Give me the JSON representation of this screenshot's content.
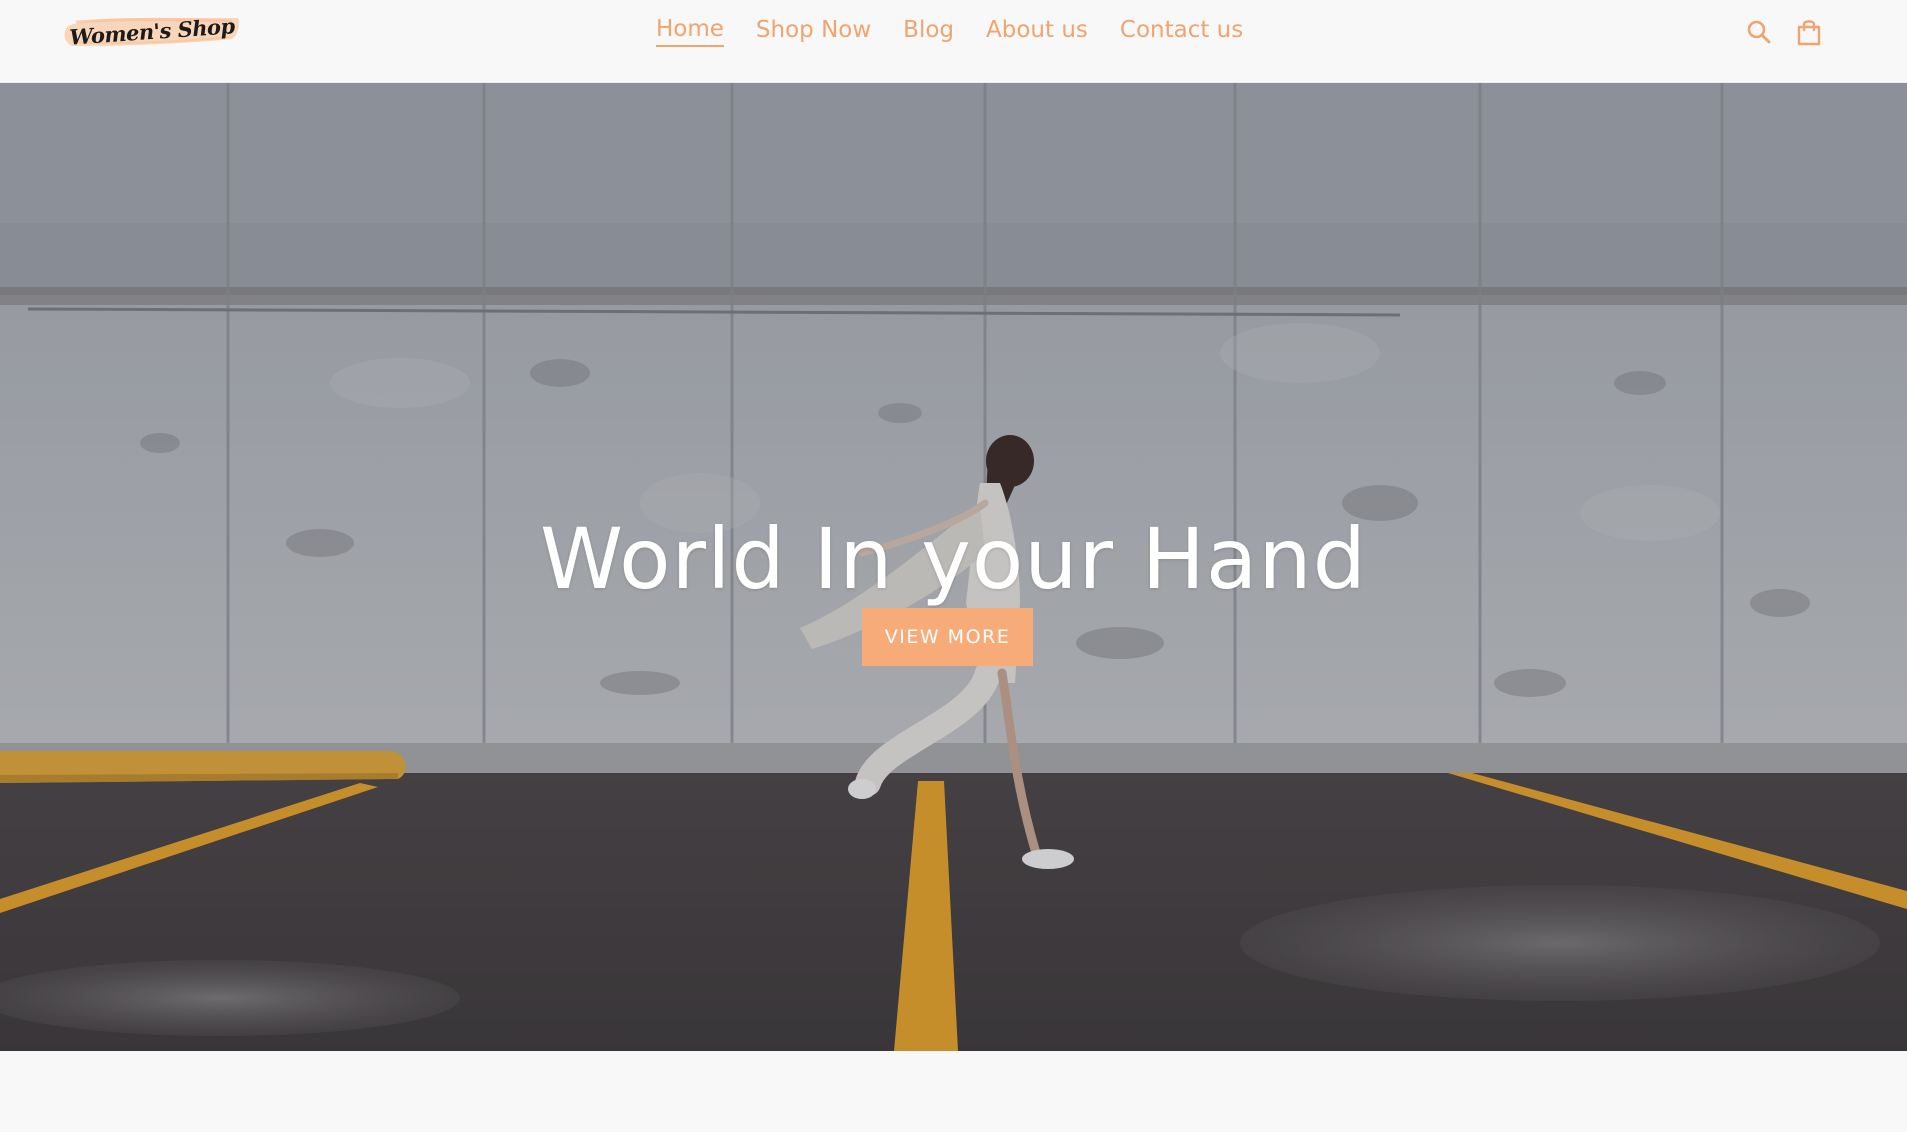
{
  "brand": {
    "logo_text": "Women's Shop"
  },
  "nav": {
    "items": [
      {
        "label": "Home",
        "active": true
      },
      {
        "label": "Shop Now",
        "active": false
      },
      {
        "label": "Blog",
        "active": false
      },
      {
        "label": "About us",
        "active": false
      },
      {
        "label": "Contact us",
        "active": false
      }
    ]
  },
  "header_icons": {
    "search": "search-icon",
    "cart": "shopping-bag-icon"
  },
  "hero": {
    "title": "World In your Hand",
    "button_label": "VIEW MORE"
  },
  "colors": {
    "accent": "#f0a46e",
    "button_bg": "#f7ab79",
    "background": "#f8f8f8",
    "hero_text": "#ffffff"
  }
}
